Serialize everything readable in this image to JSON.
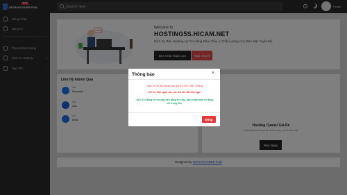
{
  "topbar": {
    "logo_text": "DICHVUCODER.FUN",
    "logo_tag": "SHOP",
    "search_placeholder": "Search Here",
    "username": "Hicam"
  },
  "sidebar": {
    "items": [
      {
        "label": "Đăng Nhập",
        "icon": "user-icon"
      },
      {
        "label": "Đăng Ký",
        "icon": "user-plus-icon"
      },
      {
        "label": "Trang Khách Hàng",
        "icon": "home-icon"
      },
      {
        "label": "Dịch Vụ Hosting",
        "icon": "server-icon"
      },
      {
        "label": "Nạp Tiền",
        "icon": "wallet-icon"
      }
    ]
  },
  "hero": {
    "welcome": "Welcome To",
    "title": "HOSTING5S.HICAM.NET",
    "description": "Dịch Vụ Bán Hosting Uy Tín Hằng Đầu Châu Á Chất Lượng Cao Bảo Mật Tuyệt Đối",
    "chat_button": "Box Chat Giao Lưu",
    "deposit_button": "Nạp nhanh"
  },
  "contacts": {
    "heading": "Liên Hệ Admin Qua",
    "items": [
      {
        "count": "4.8",
        "label": "Facebook",
        "icon": "facebook-icon"
      },
      {
        "count": "4.5",
        "label": "Zalo",
        "icon": "zalo-icon"
      },
      {
        "count": "3.9",
        "label": "Email",
        "icon": "email-icon"
      }
    ]
  },
  "product": {
    "title": "Hosting Cpanel Giá Rẻ",
    "description": "Hosting Cpanel giá rẻ chất lượng, uy tín bảo mật",
    "buy_button": "Mua Ngay"
  },
  "footer": {
    "prefix": "Designed By",
    "link": "DICHVUCODER.FUN"
  },
  "modal": {
    "title": "Thông báo",
    "line1": "- Dịch vụ ưu đãi thanh toán giá rẻ chỉ từ 25k/ 1 tháng",
    "line2": "- Hỗ trợ đầu ngàn chu các đối tác đã thuê app !",
    "line3": "- DEV CU đang hỗ trợ nạp tiền bằng thẻ cào, atm hoàn toàn tự động chỉ trong 30s",
    "close_button": "Đóng"
  }
}
